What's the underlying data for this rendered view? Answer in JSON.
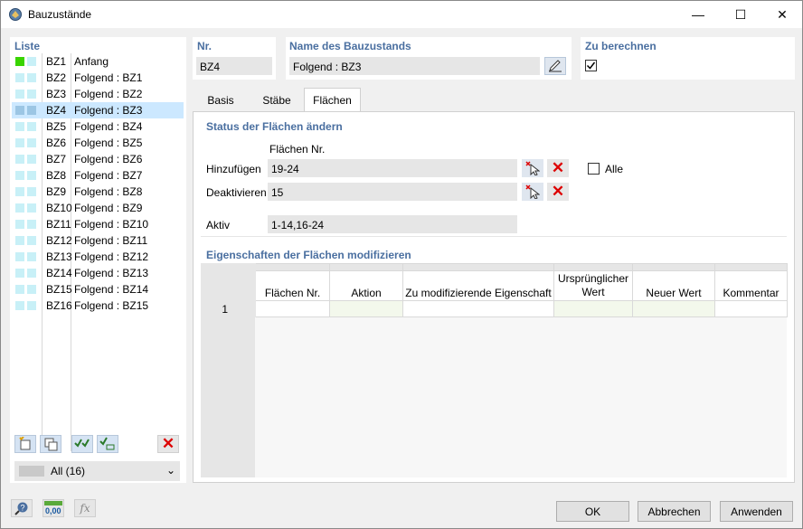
{
  "window": {
    "title": "Bauzustände",
    "minimize": "—",
    "maximize": "☐",
    "close": "✕"
  },
  "list": {
    "header": "Liste",
    "items": [
      {
        "code": "BZ1",
        "name": "Anfang",
        "color": "#39d400",
        "selected": false
      },
      {
        "code": "BZ2",
        "name": "Folgend : BZ1",
        "color": "#c8f0f7",
        "selected": false
      },
      {
        "code": "BZ3",
        "name": "Folgend : BZ2",
        "color": "#c8f0f7",
        "selected": false
      },
      {
        "code": "BZ4",
        "name": "Folgend : BZ3",
        "color": "#c8f0f7",
        "selected": true
      },
      {
        "code": "BZ5",
        "name": "Folgend : BZ4",
        "color": "#c8f0f7",
        "selected": false
      },
      {
        "code": "BZ6",
        "name": "Folgend : BZ5",
        "color": "#c8f0f7",
        "selected": false
      },
      {
        "code": "BZ7",
        "name": "Folgend : BZ6",
        "color": "#c8f0f7",
        "selected": false
      },
      {
        "code": "BZ8",
        "name": "Folgend : BZ7",
        "color": "#c8f0f7",
        "selected": false
      },
      {
        "code": "BZ9",
        "name": "Folgend : BZ8",
        "color": "#c8f0f7",
        "selected": false
      },
      {
        "code": "BZ10",
        "name": "Folgend : BZ9",
        "color": "#c8f0f7",
        "selected": false
      },
      {
        "code": "BZ11",
        "name": "Folgend : BZ10",
        "color": "#c8f0f7",
        "selected": false
      },
      {
        "code": "BZ12",
        "name": "Folgend : BZ11",
        "color": "#c8f0f7",
        "selected": false
      },
      {
        "code": "BZ13",
        "name": "Folgend : BZ12",
        "color": "#c8f0f7",
        "selected": false
      },
      {
        "code": "BZ14",
        "name": "Folgend : BZ13",
        "color": "#c8f0f7",
        "selected": false
      },
      {
        "code": "BZ15",
        "name": "Folgend : BZ14",
        "color": "#c8f0f7",
        "selected": false
      },
      {
        "code": "BZ16",
        "name": "Folgend : BZ15",
        "color": "#c8f0f7",
        "selected": false
      }
    ],
    "filter": "All (16)"
  },
  "nr": {
    "label": "Nr.",
    "value": "BZ4"
  },
  "name": {
    "label": "Name des Bauzustands",
    "value": "Folgend : BZ3"
  },
  "calc": {
    "label": "Zu berechnen",
    "checked": true
  },
  "tabs": [
    "Basis",
    "Stäbe",
    "Flächen"
  ],
  "status": {
    "header": "Status der Flächen ändern",
    "col_label": "Flächen Nr.",
    "add_label": "Hinzufügen",
    "add_value": "19-24",
    "deact_label": "Deaktivieren",
    "deact_value": "15",
    "alle_label": "Alle",
    "active_label": "Aktiv",
    "active_value": "1-14,16-24"
  },
  "props": {
    "header": "Eigenschaften der Flächen modifizieren",
    "columns": [
      "Flächen Nr.",
      "Aktion",
      "Zu modifizierende Eigenschaft",
      "Ursprünglicher Wert",
      "Neuer Wert",
      "Kommentar"
    ],
    "row_number": "1"
  },
  "buttons": {
    "ok": "OK",
    "cancel": "Abbrechen",
    "apply": "Anwenden"
  },
  "colors": {
    "accent": "#4a6fa0",
    "selection": "#cce8ff",
    "delete": "#dd0000"
  }
}
